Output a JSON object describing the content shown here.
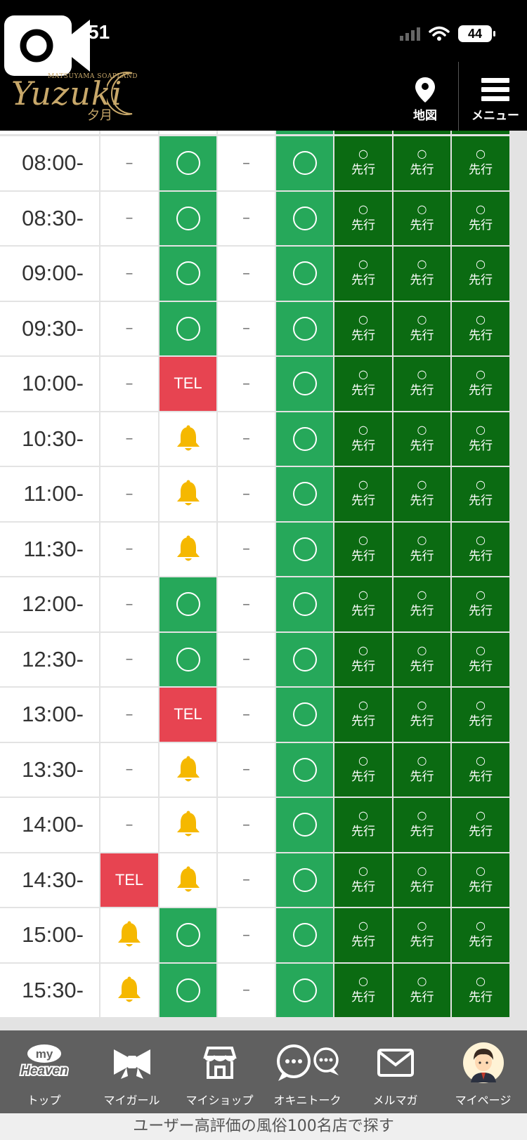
{
  "status_bar": {
    "time": "51",
    "battery": "44"
  },
  "header": {
    "logo_small": "MATSUYAMA SOAPLAND",
    "logo_script": "Yuzuki",
    "logo_kanji": "夕月",
    "map_label": "地図",
    "menu_label": "メニュー"
  },
  "schedule": {
    "rows": [
      {
        "time": "08:00-",
        "cells": [
          "dash",
          "green",
          "dash",
          "green",
          "dark",
          "dark",
          "dark"
        ]
      },
      {
        "time": "08:30-",
        "cells": [
          "dash",
          "green",
          "dash",
          "green",
          "dark",
          "dark",
          "dark"
        ]
      },
      {
        "time": "09:00-",
        "cells": [
          "dash",
          "green",
          "dash",
          "green",
          "dark",
          "dark",
          "dark"
        ]
      },
      {
        "time": "09:30-",
        "cells": [
          "dash",
          "green",
          "dash",
          "green",
          "dark",
          "dark",
          "dark"
        ]
      },
      {
        "time": "10:00-",
        "cells": [
          "dash",
          "tel",
          "dash",
          "green",
          "dark",
          "dark",
          "dark"
        ]
      },
      {
        "time": "10:30-",
        "cells": [
          "dash",
          "bell",
          "dash",
          "green",
          "dark",
          "dark",
          "dark"
        ]
      },
      {
        "time": "11:00-",
        "cells": [
          "dash",
          "bell",
          "dash",
          "green",
          "dark",
          "dark",
          "dark"
        ]
      },
      {
        "time": "11:30-",
        "cells": [
          "dash",
          "bell",
          "dash",
          "green",
          "dark",
          "dark",
          "dark"
        ]
      },
      {
        "time": "12:00-",
        "cells": [
          "dash",
          "green",
          "dash",
          "green",
          "dark",
          "dark",
          "dark"
        ]
      },
      {
        "time": "12:30-",
        "cells": [
          "dash",
          "green",
          "dash",
          "green",
          "dark",
          "dark",
          "dark"
        ]
      },
      {
        "time": "13:00-",
        "cells": [
          "dash",
          "tel",
          "dash",
          "green",
          "dark",
          "dark",
          "dark"
        ]
      },
      {
        "time": "13:30-",
        "cells": [
          "dash",
          "bell",
          "dash",
          "green",
          "dark",
          "dark",
          "dark"
        ]
      },
      {
        "time": "14:00-",
        "cells": [
          "dash",
          "bell",
          "dash",
          "green",
          "dark",
          "dark",
          "dark"
        ]
      },
      {
        "time": "14:30-",
        "cells": [
          "tel",
          "bell",
          "dash",
          "green",
          "dark",
          "dark",
          "dark"
        ]
      },
      {
        "time": "15:00-",
        "cells": [
          "bell",
          "green",
          "dash",
          "green",
          "dark",
          "dark",
          "dark"
        ]
      },
      {
        "time": "15:30-",
        "cells": [
          "bell",
          "green",
          "dash",
          "green",
          "dark",
          "dark",
          "dark"
        ]
      }
    ],
    "dash_text": "–",
    "tel_text": "TEL",
    "advance_mark": "○",
    "advance_text": "先行",
    "colors": {
      "green": "#26a85a",
      "dark_green": "#0b6b12",
      "red": "#e74451",
      "bell": "#f5b800"
    }
  },
  "tabbar": {
    "items": [
      {
        "label": "トップ",
        "icon": "my-heaven-icon",
        "badge_top": "my",
        "badge_bottom": "Heaven"
      },
      {
        "label": "マイガール",
        "icon": "ribbon-icon"
      },
      {
        "label": "マイショップ",
        "icon": "shop-icon"
      },
      {
        "label": "オキニトーク",
        "icon": "chat-bubbles-icon"
      },
      {
        "label": "メルマガ",
        "icon": "mail-icon"
      },
      {
        "label": "マイページ",
        "icon": "avatar-icon"
      }
    ]
  },
  "banner": {
    "text": "ユーザー高評価の風俗100名店で探す"
  }
}
